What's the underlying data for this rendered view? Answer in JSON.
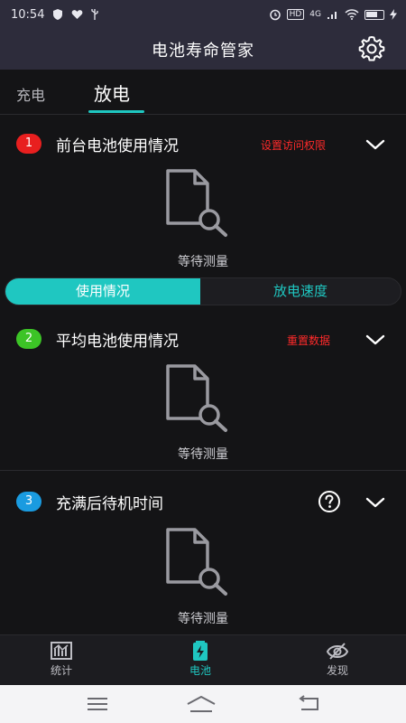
{
  "status": {
    "time": "10:54",
    "network": "4G",
    "hd": "HD"
  },
  "app": {
    "title": "电池寿命管家"
  },
  "tabs": {
    "charge": "充电",
    "discharge": "放电"
  },
  "sections": [
    {
      "number": "1",
      "title": "前台电池使用情况",
      "action": "设置访问权限",
      "empty_text": "等待测量",
      "badge_color": "#e81f1f"
    },
    {
      "number": "2",
      "title": "平均电池使用情况",
      "action": "重置数据",
      "empty_text": "等待测量",
      "badge_color": "#3cc426"
    },
    {
      "number": "3",
      "title": "充满后待机时间",
      "empty_text": "等待测量",
      "badge_color": "#1a9be0"
    }
  ],
  "toggle": {
    "usage": "使用情况",
    "speed": "放电速度"
  },
  "bottom_nav": {
    "stats": "统计",
    "battery": "电池",
    "discover": "发现"
  },
  "colors": {
    "accent": "#1fc7c1",
    "warning": "#ff2a2a",
    "background": "#141416",
    "header": "#2d2c3b"
  }
}
